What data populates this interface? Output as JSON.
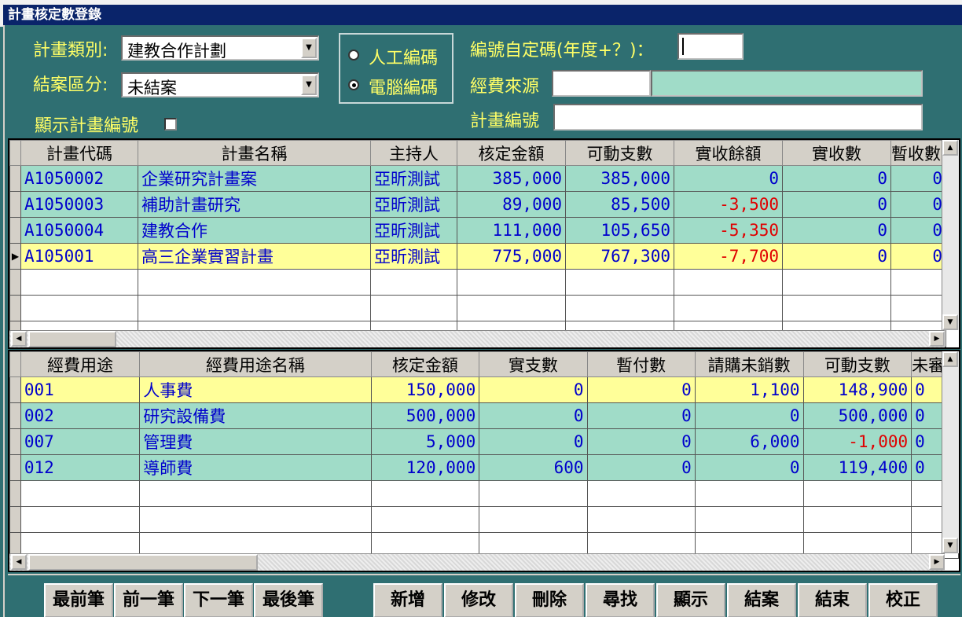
{
  "window": {
    "title": "計畫核定數登錄"
  },
  "filters": {
    "plan_type_label": "計畫類別:",
    "plan_type_value": "建教合作計劃",
    "close_type_label": "結案區分:",
    "close_type_value": "未結案",
    "show_plan_no_label": "顯示計畫編號",
    "manual_code_label": "人工編碼",
    "auto_code_label": "電腦編碼",
    "custom_code_label": "編號自定碼(年度+？)：",
    "custom_code_value": "",
    "funding_source_label": "經費來源",
    "funding_source_code": "",
    "funding_source_name": "",
    "plan_no_label": "計畫編號",
    "plan_no_value": ""
  },
  "plans_grid": {
    "columns": [
      "計畫代碼",
      "計畫名稱",
      "主持人",
      "核定金額",
      "可動支數",
      "實收餘額",
      "實收數",
      "暫收數"
    ],
    "rows": [
      [
        "A1050002",
        "企業研究計畫案",
        "亞昕測試",
        "385,000",
        "385,000",
        "0",
        "0",
        "0"
      ],
      [
        "A1050003",
        "補助計畫研究",
        "亞昕測試",
        "89,000",
        "85,500",
        "-3,500",
        "0",
        "0"
      ],
      [
        "A1050004",
        "建教合作",
        "亞昕測試",
        "111,000",
        "105,650",
        "-5,350",
        "0",
        "0"
      ],
      [
        "A105001",
        "高三企業實習計畫",
        "亞昕測試",
        "775,000",
        "767,300",
        "-7,700",
        "0",
        "0"
      ]
    ],
    "current_row_marker": "▶"
  },
  "items_grid": {
    "columns": [
      "經費用途",
      "經費用途名稱",
      "核定金額",
      "實支數",
      "暫付數",
      "請購未銷數",
      "可動支數",
      "未審"
    ],
    "rows": [
      [
        "001",
        "人事費",
        "150,000",
        "0",
        "0",
        "1,100",
        "148,900",
        "0"
      ],
      [
        "002",
        "研究設備費",
        "500,000",
        "0",
        "0",
        "0",
        "500,000",
        "0"
      ],
      [
        "007",
        "管理費",
        "5,000",
        "0",
        "0",
        "6,000",
        "-1,000",
        "0"
      ],
      [
        "012",
        "導師費",
        "120,000",
        "600",
        "0",
        "0",
        "119,400",
        "0"
      ]
    ]
  },
  "scroll_icons": {
    "up": "▲",
    "down": "▼",
    "left": "◀",
    "right": "▶",
    "combo": "▼"
  },
  "buttons": {
    "first": "最前筆",
    "prev": "前一筆",
    "next": "下一筆",
    "last": "最後筆",
    "add": "新增",
    "edit": "修改",
    "delete": "刪除",
    "find": "尋找",
    "show": "顯示",
    "close_case": "結案",
    "exit": "結束",
    "calibrate": "校正"
  },
  "colors": {
    "background": "#2f6f72",
    "label": "#ffff66",
    "row_green": "#a0dcc8",
    "row_yellow": "#ffff99",
    "negative": "#e00000",
    "value_text": "#0000cc"
  }
}
